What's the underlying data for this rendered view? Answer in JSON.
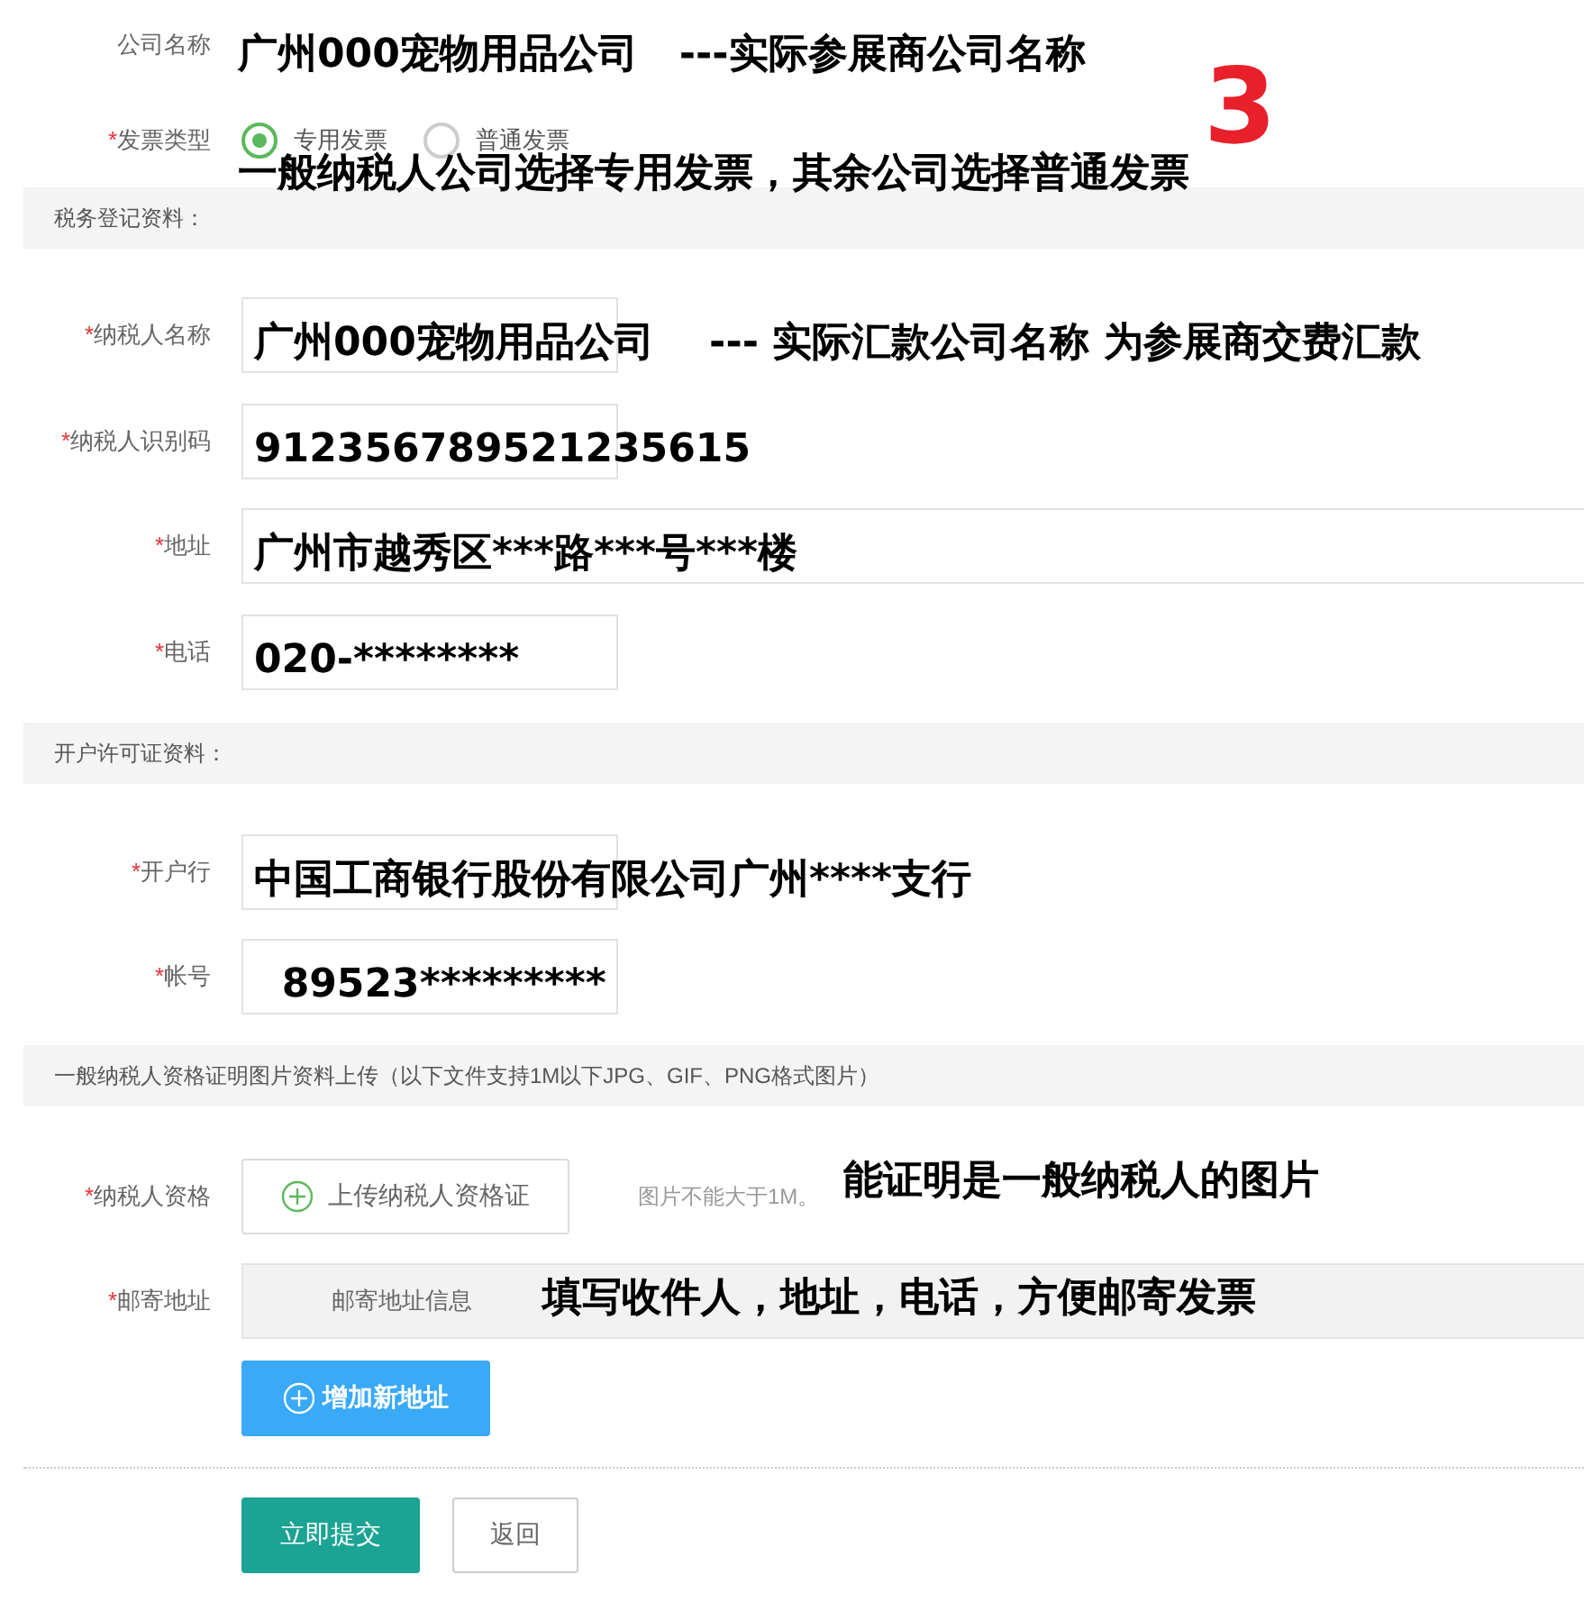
{
  "company": {
    "label": "公司名称",
    "note": "广州000宠物用品公司   ---实际参展商公司名称"
  },
  "step_number": "3",
  "invoice_type": {
    "mark": "*",
    "label": "发票类型",
    "options": [
      {
        "label": "专用发票",
        "selected": true
      },
      {
        "label": "普通发票",
        "selected": false
      }
    ],
    "note": "一般纳税人公司选择专用发票，其余公司选择普通发票"
  },
  "sections": [
    {
      "title": "税务登记资料：",
      "fields": [
        {
          "mark": "*",
          "label": "纳税人名称",
          "wide": false,
          "value": "广州000宠物用品公司    --- 实际汇款公司名称 为参展商交费汇款"
        },
        {
          "mark": "*",
          "label": "纳税人识别码",
          "wide": false,
          "value": "912356789521235615"
        },
        {
          "mark": "*",
          "label": "地址",
          "wide": true,
          "value": "广州市越秀区***路***号***楼"
        },
        {
          "mark": "*",
          "label": "电话",
          "wide": false,
          "value": "020-********"
        }
      ]
    },
    {
      "title": "开户许可证资料：",
      "fields": [
        {
          "mark": "*",
          "label": "开户行",
          "wide": false,
          "value": "中国工商银行股份有限公司广州****支行"
        },
        {
          "mark": "*",
          "label": "帐号",
          "wide": false,
          "value": "  89523*********"
        }
      ]
    },
    {
      "title": "一般纳税人资格证明图片资料上传（以下文件支持1M以下JPG、GIF、PNG格式图片）"
    }
  ],
  "upload": {
    "mark": "*",
    "label": "纳税人资格",
    "button": "上传纳税人资格证",
    "hint": "图片不能大于1M。",
    "note": "能证明是一般纳税人的图片"
  },
  "mailing": {
    "mark": "*",
    "label": "邮寄地址",
    "info": "邮寄地址信息",
    "note": "填写收件人，地址，电话，方便邮寄发票",
    "add_button": "增加新地址"
  },
  "buttons": [
    {
      "label": "立即提交",
      "kind": "primary"
    },
    {
      "label": "返回",
      "kind": "secondary"
    }
  ]
}
